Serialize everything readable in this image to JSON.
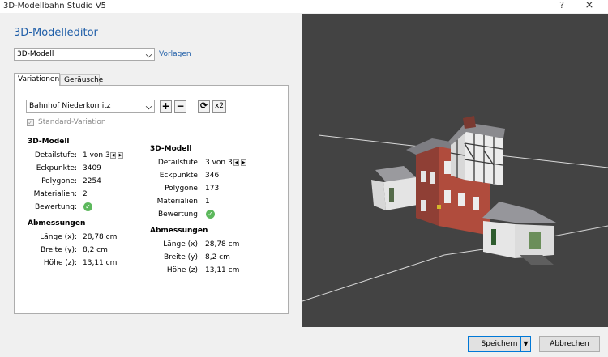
{
  "window": {
    "title": "3D-Modellbahn Studio V5",
    "help_glyph": "?",
    "close_glyph": "×"
  },
  "editor": {
    "heading": "3D-Modelleditor",
    "type_select": {
      "value": "3D-Modell"
    },
    "templates_link": "Vorlagen"
  },
  "tabs": [
    {
      "label": "Variationen"
    },
    {
      "label": "Geräusche"
    }
  ],
  "variation": {
    "select_value": "Bahnhof Niederkornitz",
    "add_glyph": "+",
    "remove_glyph": "−",
    "refresh_glyph": "⟳",
    "x2_label": "x2",
    "standard_label": "Standard-Variation",
    "standard_checked": true
  },
  "model_left": {
    "heading": "3D-Modell",
    "rows": [
      {
        "label": "Detailstufe:",
        "value": "1 von 3"
      },
      {
        "label": "Eckpunkte:",
        "value": "3409"
      },
      {
        "label": "Polygone:",
        "value": "2254"
      },
      {
        "label": "Materialien:",
        "value": "2"
      },
      {
        "label": "Bewertung:",
        "value": ""
      }
    ],
    "dims_heading": "Abmessungen",
    "dims": [
      {
        "label": "Länge (x):",
        "value": "28,78 cm"
      },
      {
        "label": "Breite (y):",
        "value": "8,2 cm"
      },
      {
        "label": "Höhe (z):",
        "value": "13,11 cm"
      }
    ]
  },
  "model_right": {
    "heading": "3D-Modell",
    "rows": [
      {
        "label": "Detailstufe:",
        "value": "3 von 3"
      },
      {
        "label": "Eckpunkte:",
        "value": "346"
      },
      {
        "label": "Polygone:",
        "value": "173"
      },
      {
        "label": "Materialien:",
        "value": "1"
      },
      {
        "label": "Bewertung:",
        "value": ""
      }
    ],
    "dims_heading": "Abmessungen",
    "dims": [
      {
        "label": "Länge (x):",
        "value": "28,78 cm"
      },
      {
        "label": "Breite (y):",
        "value": "8,2 cm"
      },
      {
        "label": "Höhe (z):",
        "value": "13,11 cm"
      }
    ]
  },
  "footer": {
    "save_label": "Speichern",
    "cancel_label": "Abbrechen"
  },
  "colors": {
    "accent": "#1f5ea8",
    "viewport_bg": "#434343",
    "brick": "#a8493b",
    "roof": "#8a8a8e",
    "rating_ok": "#5cb85c"
  },
  "icons": {
    "stepper": "arrow-left-right-icon",
    "rating": "check-circle-icon",
    "refresh": "refresh-icon"
  }
}
